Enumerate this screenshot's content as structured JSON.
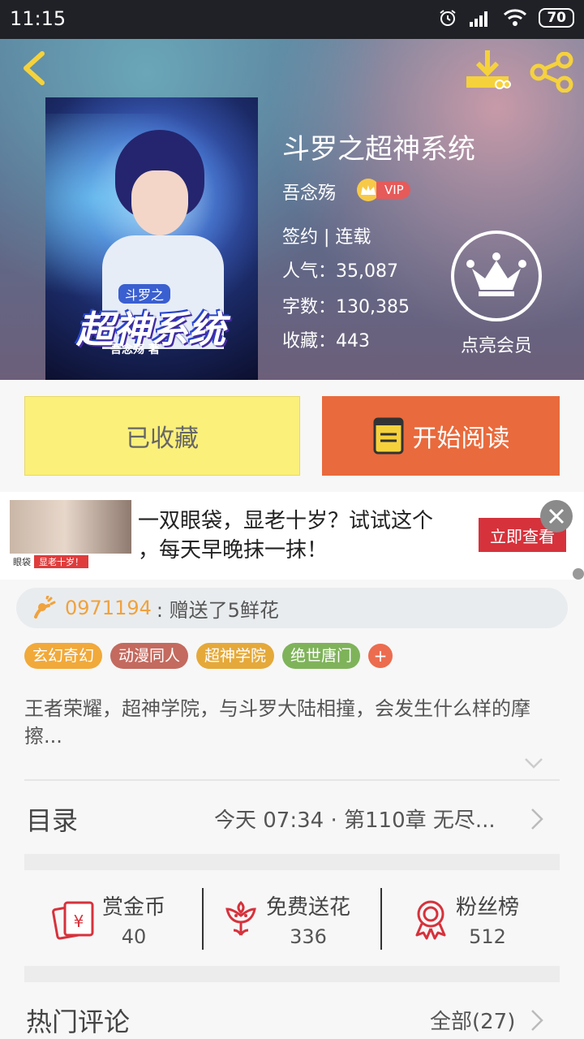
{
  "status": {
    "time": "11:15",
    "battery": "70"
  },
  "book": {
    "title": "斗罗之超神系统",
    "author": "吾念殇",
    "vip": "VIP",
    "status": "签约 | 连载",
    "popularity": "人气：35,087",
    "words": "字数：130,385",
    "favorites": "收藏：443",
    "member": "点亮会员",
    "cover": {
      "series": "斗罗之",
      "title": "超神系统",
      "author": "吾念殇 著"
    }
  },
  "actions": {
    "collected": "已收藏",
    "read": "开始阅读"
  },
  "ad": {
    "line1": "一双眼袋，显老十岁？试试这个",
    "line2": "，每天早晚抹一抹！",
    "button": "立即查看",
    "badge_brand": "眼袋",
    "badge_red": "显老十岁！"
  },
  "gift": {
    "uid": "0971194",
    "message": ": 赠送了5鲜花"
  },
  "tags": [
    {
      "label": "玄幻奇幻",
      "color": "#f1a93a"
    },
    {
      "label": "动漫同人",
      "color": "#c46a5f"
    },
    {
      "label": "超神学院",
      "color": "#e5a93a"
    },
    {
      "label": "绝世唐门",
      "color": "#7fb35a"
    }
  ],
  "description": "王者荣耀，超神学院，与斗罗大陆相撞，会发生什么样的摩擦...",
  "toc": {
    "label": "目录",
    "latest": "今天 07:34 · 第110章 无尽..."
  },
  "stats": [
    {
      "name": "赏金币",
      "value": "40",
      "icon": "red-envelope-icon"
    },
    {
      "name": "免费送花",
      "value": "336",
      "icon": "flower-icon"
    },
    {
      "name": "粉丝榜",
      "value": "512",
      "icon": "medal-icon"
    }
  ],
  "comments": {
    "label": "热门评论",
    "all": "全部(27)"
  }
}
